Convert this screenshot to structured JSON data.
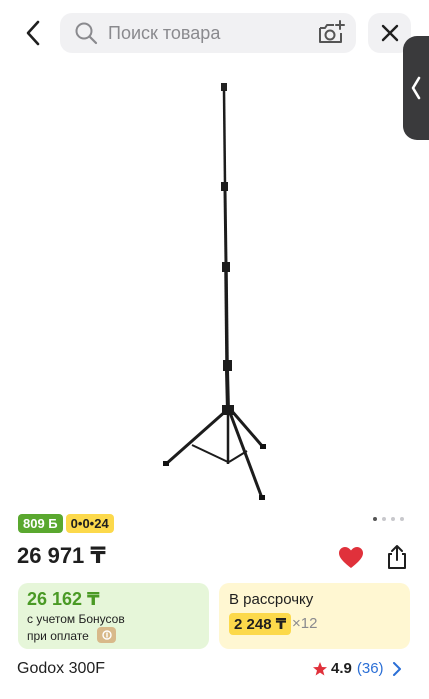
{
  "search": {
    "placeholder": "Поиск товара"
  },
  "badges": {
    "bonus": "809 Б",
    "installment": "0•0•24"
  },
  "price": "26 971 ₸",
  "bonus_card": {
    "price": "26 162 ₸",
    "line1": "с учетом Бонусов",
    "line2": "при оплате"
  },
  "installment_card": {
    "title": "В рассрочку",
    "amount": "2 248 ₸",
    "times": "×12"
  },
  "product": {
    "name": "Godox 300F"
  },
  "rating": {
    "value": "4.9",
    "count": "(36)"
  },
  "gallery": {
    "total": 4,
    "active_index": 0
  },
  "colors": {
    "accent_green": "#5aa82f",
    "accent_yellow": "#fcd94b",
    "heart_red": "#e0313b",
    "link_blue": "#2b6fd6"
  },
  "icons": [
    "back-arrow-icon",
    "search-icon",
    "camera-icon",
    "close-icon",
    "chevron-left-icon",
    "heart-icon",
    "share-icon",
    "star-icon",
    "chevron-right-icon"
  ]
}
